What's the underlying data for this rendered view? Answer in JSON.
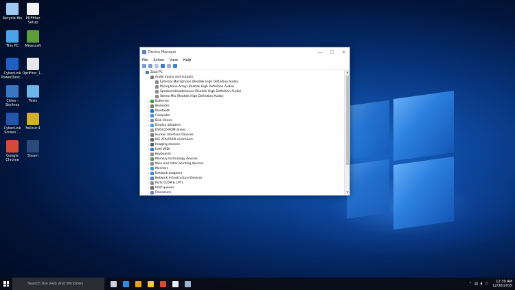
{
  "desktop": {
    "icons": [
      {
        "label": "Recycle Bin",
        "color": "#9ec9f0"
      },
      {
        "label": "PDFfiller Setup",
        "color": "#f2f2f2"
      },
      {
        "label": "This PC",
        "color": "#4aa3e6"
      },
      {
        "label": "Minecraft",
        "color": "#5e9c3a"
      },
      {
        "label": "CyberLink PowerDirec...",
        "color": "#1e5fc1"
      },
      {
        "label": "OptiFine_1...",
        "color": "#e7e7e7"
      },
      {
        "label": "Cities - Skylines",
        "color": "#3a76c4"
      },
      {
        "label": "Tesis",
        "color": "#6ab6e8"
      },
      {
        "label": "CyberLink Screen ...",
        "color": "#2356a8"
      },
      {
        "label": "Fallout 4",
        "color": "#d4b02a"
      },
      {
        "label": "Google Chrome",
        "color": "#d64a3a"
      },
      {
        "label": "Steam",
        "color": "#2a4b79"
      }
    ]
  },
  "window": {
    "title": "Device Manager",
    "controls": {
      "minimize": "—",
      "maximize": "☐",
      "close": "✕"
    },
    "menu": [
      "File",
      "Action",
      "View",
      "Help"
    ],
    "tree": [
      {
        "label": "Zack-PC",
        "level": 0,
        "exp": "⌄",
        "color": "#4a7fc0"
      },
      {
        "label": "Audio inputs and outputs",
        "level": 1,
        "exp": "⌄",
        "color": "#7a7a7a"
      },
      {
        "label": "External Microphone (Realtek High Definition Audio)",
        "level": 2,
        "exp": "",
        "color": "#8a8a8a"
      },
      {
        "label": "Microphone Array (Realtek High Definition Audio)",
        "level": 2,
        "exp": "",
        "color": "#8a8a8a"
      },
      {
        "label": "Speakers/Headphones (Realtek High Definition Audio)",
        "level": 2,
        "exp": "",
        "color": "#8a8a8a"
      },
      {
        "label": "Stereo Mix (Realtek High Definition Audio)",
        "level": 2,
        "exp": "",
        "color": "#8a8a8a"
      },
      {
        "label": "Batteries",
        "level": 1,
        "exp": "›",
        "color": "#3f9a3f"
      },
      {
        "label": "Biometric",
        "level": 1,
        "exp": "›",
        "color": "#7a7a7a"
      },
      {
        "label": "Bluetooth",
        "level": 1,
        "exp": "›",
        "color": "#1f6fd6"
      },
      {
        "label": "Computer",
        "level": 1,
        "exp": "›",
        "color": "#4a8fd8"
      },
      {
        "label": "Disk drives",
        "level": 1,
        "exp": "›",
        "color": "#8a8a8a"
      },
      {
        "label": "Display adapters",
        "level": 1,
        "exp": "›",
        "color": "#4aa0d8"
      },
      {
        "label": "DVD/CD-ROM drives",
        "level": 1,
        "exp": "›",
        "color": "#9a9a9a"
      },
      {
        "label": "Human Interface Devices",
        "level": 1,
        "exp": "›",
        "color": "#7a7a7a"
      },
      {
        "label": "IDE ATA/ATAPI controllers",
        "level": 1,
        "exp": "›",
        "color": "#6a6a6a"
      },
      {
        "label": "Imaging devices",
        "level": 1,
        "exp": "›",
        "color": "#5a5a5a"
      },
      {
        "label": "Intel WiDi",
        "level": 1,
        "exp": "›",
        "color": "#3a7ad0"
      },
      {
        "label": "Keyboards",
        "level": 1,
        "exp": "›",
        "color": "#8a8a8a"
      },
      {
        "label": "Memory technology devices",
        "level": 1,
        "exp": "›",
        "color": "#5a9a5a"
      },
      {
        "label": "Mice and other pointing devices",
        "level": 1,
        "exp": "›",
        "color": "#8a8a8a"
      },
      {
        "label": "Monitors",
        "level": 1,
        "exp": "›",
        "color": "#4a90d8"
      },
      {
        "label": "Network adapters",
        "level": 1,
        "exp": "›",
        "color": "#4a7fc0"
      },
      {
        "label": "Network Infrastructure Devices",
        "level": 1,
        "exp": "›",
        "color": "#4a7fc0"
      },
      {
        "label": "Ports (COM & LPT)",
        "level": 1,
        "exp": "›",
        "color": "#8a8a8a"
      },
      {
        "label": "Print queues",
        "level": 1,
        "exp": "›",
        "color": "#6a6a6a"
      },
      {
        "label": "Processors",
        "level": 1,
        "exp": "›",
        "color": "#6a8aa0"
      }
    ]
  },
  "taskbar": {
    "search_placeholder": "Search the web and Windows",
    "apps": [
      {
        "name": "task-view-icon",
        "color": "#cfd3da"
      },
      {
        "name": "edge-icon",
        "color": "#2f8be6"
      },
      {
        "name": "media-player-icon",
        "color": "#e8a318"
      },
      {
        "name": "folder-icon",
        "color": "#f2c744"
      },
      {
        "name": "chrome-icon",
        "color": "#d64a3a"
      },
      {
        "name": "photos-icon",
        "color": "#e9eef5"
      },
      {
        "name": "steam-icon",
        "color": "#9fb3cc"
      }
    ],
    "time": "12:39 AM",
    "date": "12/30/2015"
  }
}
